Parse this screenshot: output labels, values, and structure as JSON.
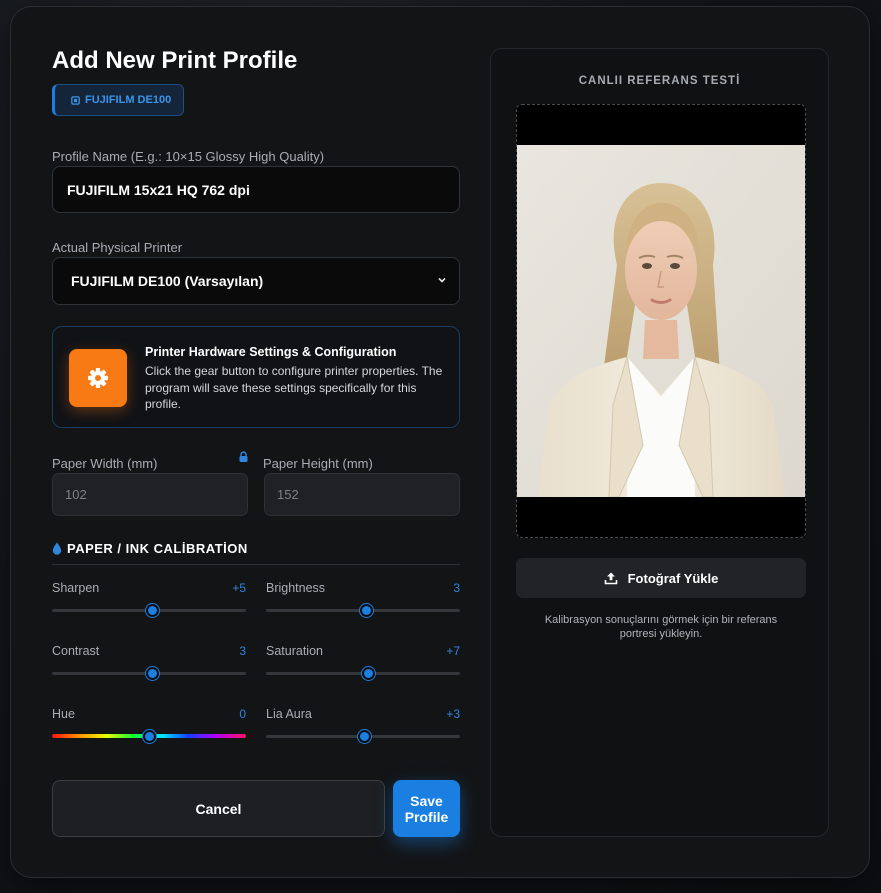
{
  "modal": {
    "title": "Add New Print Profile",
    "badge": "FUJIFILM DE100"
  },
  "profile_name": {
    "label": "Profile Name (E.g.: 10×15 Glossy High Quality)",
    "value": "FUJIFILM 15x21 HQ 762 dpi"
  },
  "printer": {
    "label": "Actual Physical Printer",
    "selected": "FUJIFILM DE100 (Varsayılan)"
  },
  "hardware": {
    "title": "Printer Hardware Settings & Configuration",
    "description": "Click the gear button to configure printer properties. The program will save these settings specifically for this profile."
  },
  "paper": {
    "width_label": "Paper Width (mm)",
    "width_value": "102",
    "height_label": "Paper Height (mm)",
    "height_value": "152"
  },
  "calibration": {
    "title": "PAPER / INK CALİBRATİON",
    "sliders": [
      {
        "label": "Sharpen",
        "value": "+5",
        "fraction": 0.52
      },
      {
        "label": "Brightness",
        "value": "3",
        "fraction": 0.52
      },
      {
        "label": "Contrast",
        "value": "3",
        "fraction": 0.52
      },
      {
        "label": "Saturation",
        "value": "+7",
        "fraction": 0.53
      },
      {
        "label": "Hue",
        "value": "0",
        "fraction": 0.5
      },
      {
        "label": "Lia Aura",
        "value": "+3",
        "fraction": 0.51
      }
    ]
  },
  "actions": {
    "cancel": "Cancel",
    "save": "Save Profile"
  },
  "reference": {
    "title": "CANLII REFERANS TESTİ",
    "upload_label": "Fotoğraf Yükle",
    "hint": "Kalibrasyon sonuçlarını görmek için bir referans portresi yükleyin."
  },
  "colors": {
    "accent": "#1a7fe0",
    "gear": "#f77a14"
  }
}
